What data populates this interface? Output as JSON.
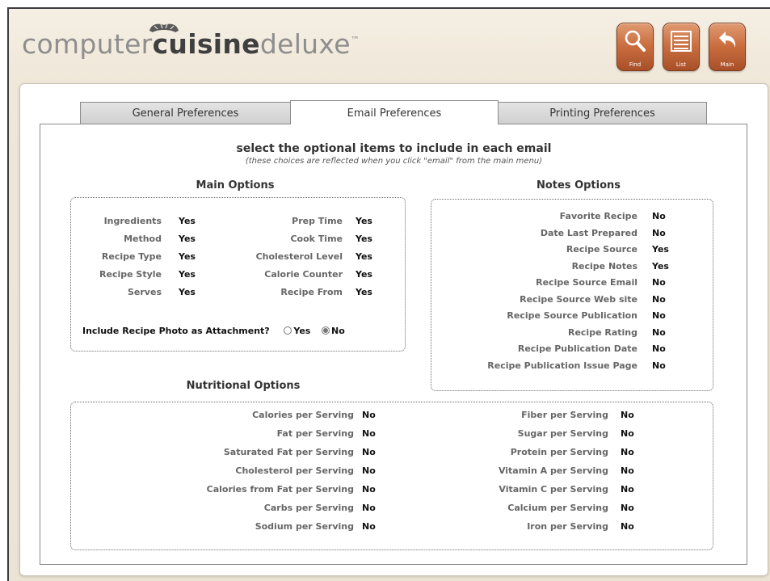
{
  "app": {
    "logo_light_1": "computer",
    "logo_bold": "cuisine",
    "logo_light_2": "deluxe",
    "logo_mark": "™"
  },
  "toolbar": {
    "find_label": "Find",
    "list_label": "List",
    "main_label": "Main"
  },
  "tabs": [
    {
      "label": "General Preferences",
      "active": false
    },
    {
      "label": "Email Preferences",
      "active": true
    },
    {
      "label": "Printing Preferences",
      "active": false
    }
  ],
  "heading": "select the optional items to include in each email",
  "subheading": "(these choices are reflected when you click \"email\" from the main menu)",
  "main_options": {
    "title": "Main Options",
    "left": [
      {
        "label": "Ingredients",
        "value": "Yes"
      },
      {
        "label": "Method",
        "value": "Yes"
      },
      {
        "label": "Recipe Type",
        "value": "Yes"
      },
      {
        "label": "Recipe Style",
        "value": "Yes"
      },
      {
        "label": "Serves",
        "value": "Yes"
      }
    ],
    "right": [
      {
        "label": "Prep Time",
        "value": "Yes"
      },
      {
        "label": "Cook Time",
        "value": "Yes"
      },
      {
        "label": "Cholesterol Level",
        "value": "Yes"
      },
      {
        "label": "Calorie Counter",
        "value": "Yes"
      },
      {
        "label": "Recipe From",
        "value": "Yes"
      }
    ],
    "photo_question": "Include Recipe Photo as Attachment?",
    "photo_yes": "Yes",
    "photo_no": "No",
    "photo_selected": "No"
  },
  "notes_options": {
    "title": "Notes Options",
    "items": [
      {
        "label": "Favorite Recipe",
        "value": "No"
      },
      {
        "label": "Date Last Prepared",
        "value": "No"
      },
      {
        "label": "Recipe Source",
        "value": "Yes"
      },
      {
        "label": "Recipe Notes",
        "value": "Yes"
      },
      {
        "label": "Recipe Source Email",
        "value": "No"
      },
      {
        "label": "Recipe Source Web site",
        "value": "No"
      },
      {
        "label": "Recipe Source Publication",
        "value": "No"
      },
      {
        "label": "Recipe Rating",
        "value": "No"
      },
      {
        "label": "Recipe Publication Date",
        "value": "No"
      },
      {
        "label": "Recipe Publication Issue Page",
        "value": "No"
      }
    ]
  },
  "nutritional_options": {
    "title": "Nutritional Options",
    "left": [
      {
        "label": "Calories per Serving",
        "value": "No"
      },
      {
        "label": "Fat per Serving",
        "value": "No"
      },
      {
        "label": "Saturated Fat per Serving",
        "value": "No"
      },
      {
        "label": "Cholesterol per Serving",
        "value": "No"
      },
      {
        "label": "Calories from Fat per Serving",
        "value": "No"
      },
      {
        "label": "Carbs per Serving",
        "value": "No"
      },
      {
        "label": "Sodium per Serving",
        "value": "No"
      }
    ],
    "right": [
      {
        "label": "Fiber per Serving",
        "value": "No"
      },
      {
        "label": "Sugar per Serving",
        "value": "No"
      },
      {
        "label": "Protein per Serving",
        "value": "No"
      },
      {
        "label": "Vitamin A per Serving",
        "value": "No"
      },
      {
        "label": "Vitamin C per Serving",
        "value": "No"
      },
      {
        "label": "Calcium per Serving",
        "value": "No"
      },
      {
        "label": "Iron per Serving",
        "value": "No"
      }
    ]
  }
}
